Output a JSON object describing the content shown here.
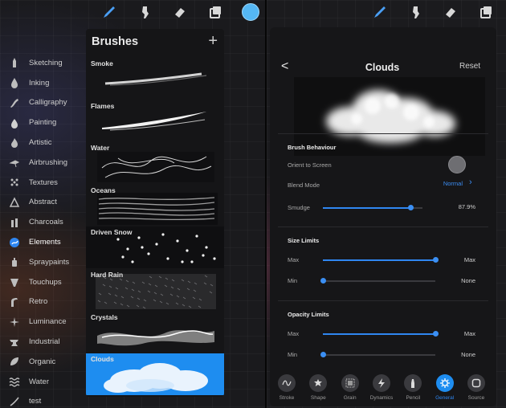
{
  "left": {
    "toolbar": {
      "icons": [
        "brush-icon",
        "smudge-icon",
        "eraser-icon",
        "layers-icon"
      ],
      "color": "#55b7f3"
    },
    "categories": [
      {
        "label": "Sketching",
        "icon": "pencil-icon"
      },
      {
        "label": "Inking",
        "icon": "ink-drop-icon"
      },
      {
        "label": "Calligraphy",
        "icon": "calligraphy-icon"
      },
      {
        "label": "Painting",
        "icon": "paint-drop-icon"
      },
      {
        "label": "Artistic",
        "icon": "flame-icon"
      },
      {
        "label": "Airbrushing",
        "icon": "airbrush-icon"
      },
      {
        "label": "Textures",
        "icon": "texture-icon"
      },
      {
        "label": "Abstract",
        "icon": "triangle-icon"
      },
      {
        "label": "Charcoals",
        "icon": "charcoal-icon"
      },
      {
        "label": "Elements",
        "icon": "elements-icon"
      },
      {
        "label": "Spraypaints",
        "icon": "spray-can-icon"
      },
      {
        "label": "Touchups",
        "icon": "touchups-icon"
      },
      {
        "label": "Retro",
        "icon": "retro-icon"
      },
      {
        "label": "Luminance",
        "icon": "sparkle-icon"
      },
      {
        "label": "Industrial",
        "icon": "anvil-icon"
      },
      {
        "label": "Organic",
        "icon": "leaf-icon"
      },
      {
        "label": "Water",
        "icon": "waves-icon"
      },
      {
        "label": "test",
        "icon": "stroke-icon"
      }
    ],
    "active_category": "Elements",
    "brushes_title": "Brushes",
    "add_label": "+",
    "brushes": [
      "Smoke",
      "Flames",
      "Water",
      "Oceans",
      "Driven Snow",
      "Hard Rain",
      "Crystals",
      "Clouds"
    ],
    "selected_brush": "Clouds"
  },
  "right": {
    "toolbar": {
      "icons": [
        "brush-icon",
        "smudge-icon",
        "eraser-icon",
        "layers-icon"
      ]
    },
    "back": "<",
    "title": "Clouds",
    "reset": "Reset",
    "brush_behaviour": {
      "heading": "Brush Behaviour",
      "orient_label": "Orient to Screen",
      "orient_on": false,
      "blend_label": "Blend Mode",
      "blend_value": "Normal",
      "smudge_label": "Smudge",
      "smudge_value": "87.9%",
      "smudge_level": 0.879
    },
    "size_limits": {
      "heading": "Size Limits",
      "max_label": "Max",
      "max_value": "Max",
      "max_level": 1.0,
      "min_label": "Min",
      "min_value": "None",
      "min_level": 0.0
    },
    "opacity_limits": {
      "heading": "Opacity Limits",
      "max_label": "Max",
      "max_value": "Max",
      "max_level": 1.0,
      "min_label": "Min",
      "min_value": "None",
      "min_level": 0.0
    },
    "tabs": [
      {
        "label": "Stroke",
        "icon": "stroke-curve-icon"
      },
      {
        "label": "Shape",
        "icon": "shape-icon"
      },
      {
        "label": "Grain",
        "icon": "grain-icon"
      },
      {
        "label": "Dynamics",
        "icon": "lightning-icon"
      },
      {
        "label": "Pencil",
        "icon": "pencil-tip-icon"
      },
      {
        "label": "General",
        "icon": "gear-icon"
      },
      {
        "label": "Source",
        "icon": "source-icon"
      }
    ],
    "active_tab": "General",
    "accent": "#1e8df0"
  }
}
